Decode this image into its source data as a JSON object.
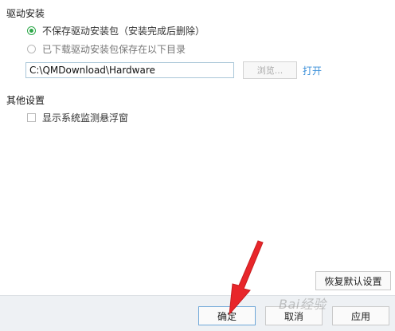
{
  "driver_section": {
    "title": "驱动安装",
    "option_no_save": "不保存驱动安装包（安装完成后删除）",
    "option_save": "已下载驱动安装包保存在以下目录",
    "path_value": "C:\\QMDownload\\Hardware",
    "browse_label": "浏览...",
    "open_label": "打开"
  },
  "other_section": {
    "title": "其他设置",
    "floating_window_label": "显示系统监测悬浮窗"
  },
  "buttons": {
    "restore_defaults": "恢复默认设置",
    "ok": "确定",
    "cancel": "取消",
    "apply": "应用"
  },
  "watermark": "Bai经验",
  "colors": {
    "accent_green": "#2ea84a",
    "link_blue": "#3a8fd9",
    "annotation_red": "#e8262a"
  }
}
